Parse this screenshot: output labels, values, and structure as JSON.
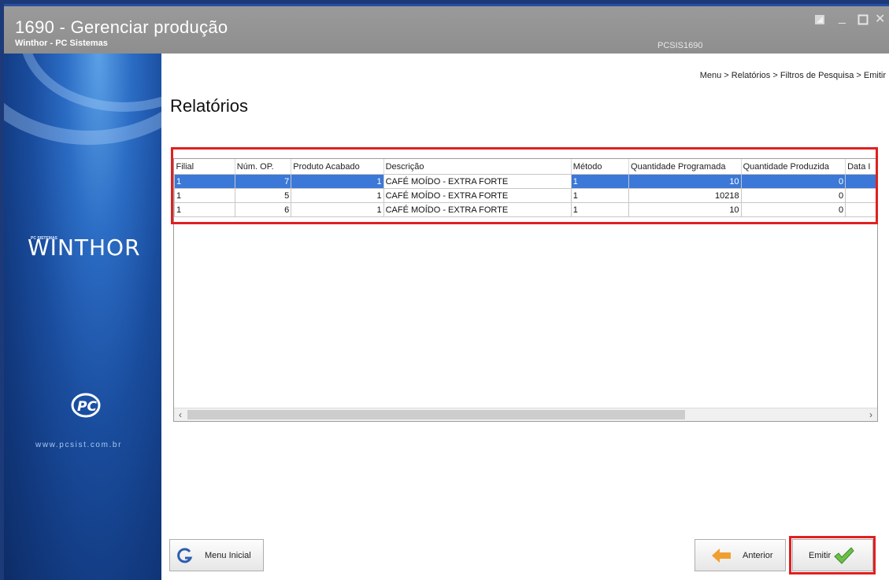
{
  "window": {
    "title": "1690 - Gerenciar produção",
    "subtitle": "Winthor - PC Sistemas",
    "code": "PCSIS1690"
  },
  "sidebar": {
    "brand_small": "PC SISTEMAS",
    "brand": "WINTHOR",
    "logo_text": "PC",
    "website": "www.pcsist.com.br"
  },
  "main": {
    "breadcrumb": "Menu > Relatórios > Filtros de Pesquisa > Emitir",
    "title": "Relatórios"
  },
  "table": {
    "columns": [
      "Filial",
      "Núm. OP.",
      "Produto Acabado",
      "Descrição",
      "Método",
      "Quantidade Programada",
      "Quantidade Produzida",
      "Data I"
    ],
    "rows": [
      {
        "filial": "1",
        "num_op": "7",
        "produto": "1",
        "descricao": "CAFÉ MOÍDO - EXTRA FORTE",
        "metodo": "1",
        "qtd_prog": "10",
        "qtd_prod": "0",
        "data": ""
      },
      {
        "filial": "1",
        "num_op": "5",
        "produto": "1",
        "descricao": "CAFÉ MOÍDO - EXTRA FORTE",
        "metodo": "1",
        "qtd_prog": "10218",
        "qtd_prod": "0",
        "data": ""
      },
      {
        "filial": "1",
        "num_op": "6",
        "produto": "1",
        "descricao": "CAFÉ MOÍDO - EXTRA FORTE",
        "metodo": "1",
        "qtd_prog": "10",
        "qtd_prod": "0",
        "data": ""
      }
    ]
  },
  "buttons": {
    "menu_inicial": "Menu Inicial",
    "anterior": "Anterior",
    "emitir": "Emitir"
  },
  "colors": {
    "selection": "#3b78d8",
    "highlight": "#e02020",
    "sidebar": "#1a4d9e"
  }
}
